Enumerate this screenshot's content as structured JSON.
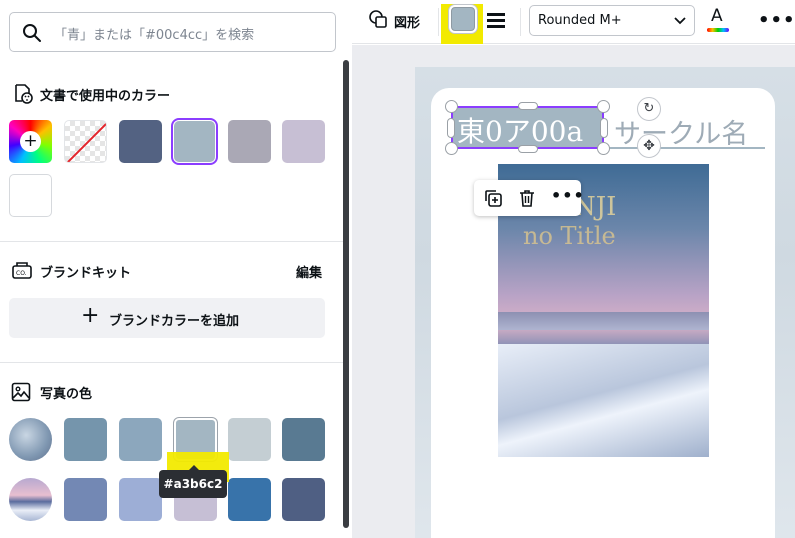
{
  "search": {
    "placeholder": "「青」または「#00c4cc」を検索"
  },
  "document_colors": {
    "title": "文書で使用中のカラー",
    "swatches": [
      "#536282",
      "#a3b6c2",
      "#aaa8b5",
      "#c7bfd4",
      "#ffffff"
    ],
    "selected": "#a3b6c2"
  },
  "brand_kit": {
    "title": "ブランドキット",
    "edit_label": "編集",
    "add_label": "ブランドカラーを追加"
  },
  "photo_colors": {
    "title": "写真の色",
    "rows": [
      [
        "#7595ac",
        "#8ca7bd",
        "#a3b6c2",
        "#c4ced3",
        "#597a92"
      ],
      [
        "#7388b4",
        "#9daed6",
        "#c6bfd5",
        "#3873aa",
        "#4f5f83"
      ]
    ]
  },
  "tooltip": {
    "text": "#a3b6c2"
  },
  "toolbar": {
    "shape_label": "図形",
    "current_color": "#a3b6c2",
    "font_name": "Rounded M+",
    "text_color_letter": "A",
    "more": "•••"
  },
  "canvas": {
    "selected_text": "東0ア00a",
    "circle_name": "サークル名",
    "photo_text_1": "NJI",
    "photo_text_2": "no Title"
  },
  "context_menu": {
    "more": "•••"
  }
}
